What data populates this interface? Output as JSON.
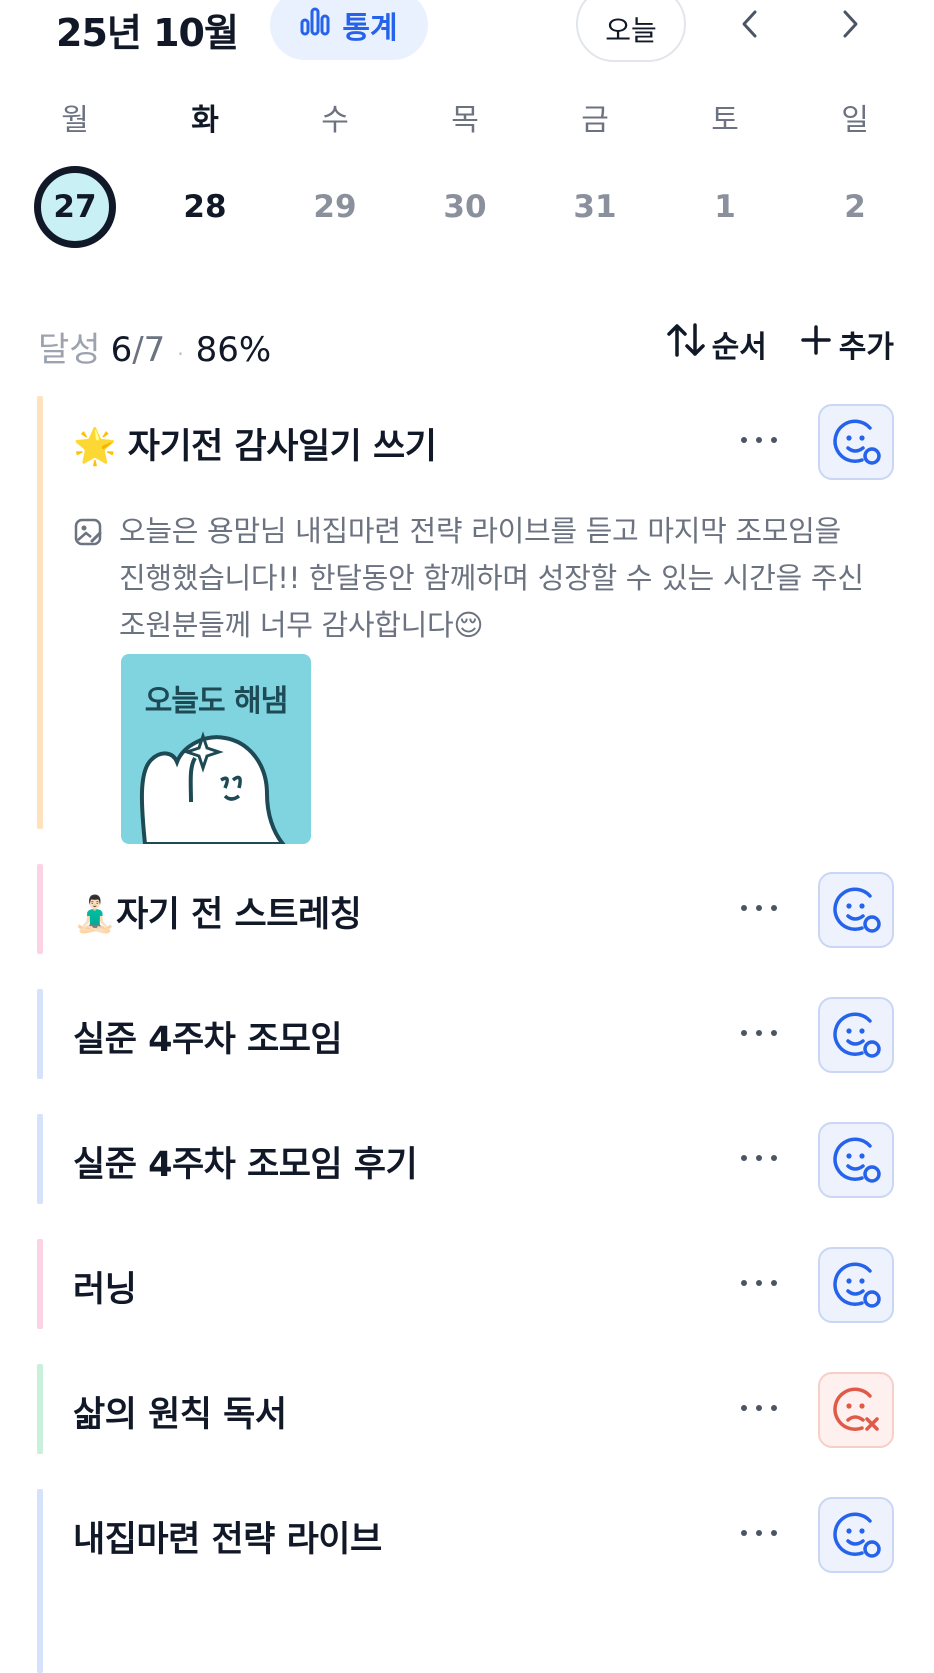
{
  "header": {
    "month_title": "25년 10월",
    "stats_label": "통계",
    "today_label": "오늘"
  },
  "week": {
    "days": [
      "월",
      "화",
      "수",
      "목",
      "금",
      "토",
      "일"
    ],
    "dates": [
      "27",
      "28",
      "29",
      "30",
      "31",
      "1",
      "2"
    ],
    "selected_index": 0
  },
  "summary": {
    "label": "달성",
    "done": "6",
    "total": "/7",
    "separator": "·",
    "percent": "86%"
  },
  "toolbar": {
    "order_label": "순서",
    "add_label": "추가"
  },
  "habits": [
    {
      "title": "🌟 자기전 감사일기 쓰기",
      "bar_color": "#fde2bd",
      "status": "done",
      "note": "오늘은 용맘님 내집마련 전략 라이브를 듣고 마지막 조모임을 진행했습니다!! 한달동안 함께하며 성장할 수 있는 시간을 주신 조원분들께 너무 감사합니다😌",
      "image_caption": "오늘도 해냄"
    },
    {
      "title": "🧘🏻‍♂️자기 전 스트레칭",
      "bar_color": "#fcd3e5",
      "status": "done"
    },
    {
      "title": "실준 4주차 조모임",
      "bar_color": "#d6e2fb",
      "status": "done"
    },
    {
      "title": "실준 4주차 조모임 후기",
      "bar_color": "#d6e2fb",
      "status": "done"
    },
    {
      "title": "러닝",
      "bar_color": "#fcd3e5",
      "status": "done"
    },
    {
      "title": "삶의 원칙 독서",
      "bar_color": "#c9f0da",
      "status": "failed"
    },
    {
      "title": "내집마련 전략 라이브",
      "bar_color": "#d6e2fb",
      "status": "done"
    }
  ],
  "colors": {
    "accent": "#2563eb",
    "fail": "#e05a48",
    "selected_date_fill": "#c8f0f5"
  },
  "icons": [
    "chart-bar-icon",
    "chevron-left-icon",
    "chevron-right-icon",
    "sort-icon",
    "plus-icon",
    "more-icon",
    "smile-check-icon",
    "sad-x-icon",
    "photo-note-icon"
  ]
}
